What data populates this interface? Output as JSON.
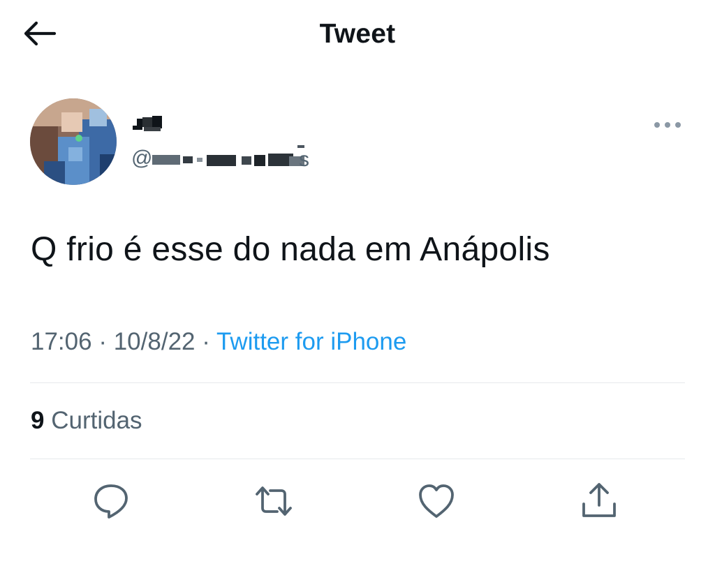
{
  "header": {
    "title": "Tweet",
    "back_icon": "arrow-left-icon"
  },
  "author": {
    "display_name": "",
    "handle_prefix": "@",
    "handle_suffix": "s",
    "avatar_icon": "profile-photo"
  },
  "tweet": {
    "text": "Q frio é esse do nada em Anápolis",
    "time": "17:06",
    "separator": "·",
    "date": "10/8/22",
    "source": "Twitter for iPhone"
  },
  "stats": {
    "likes_count": "9",
    "likes_label": "Curtidas"
  },
  "actions": {
    "reply_icon": "reply-icon",
    "retweet_icon": "retweet-icon",
    "like_icon": "heart-icon",
    "share_icon": "share-icon"
  },
  "colors": {
    "text_primary": "#0f1419",
    "text_secondary": "#536471",
    "link": "#1d9bf0",
    "divider": "#e6e9eb"
  }
}
